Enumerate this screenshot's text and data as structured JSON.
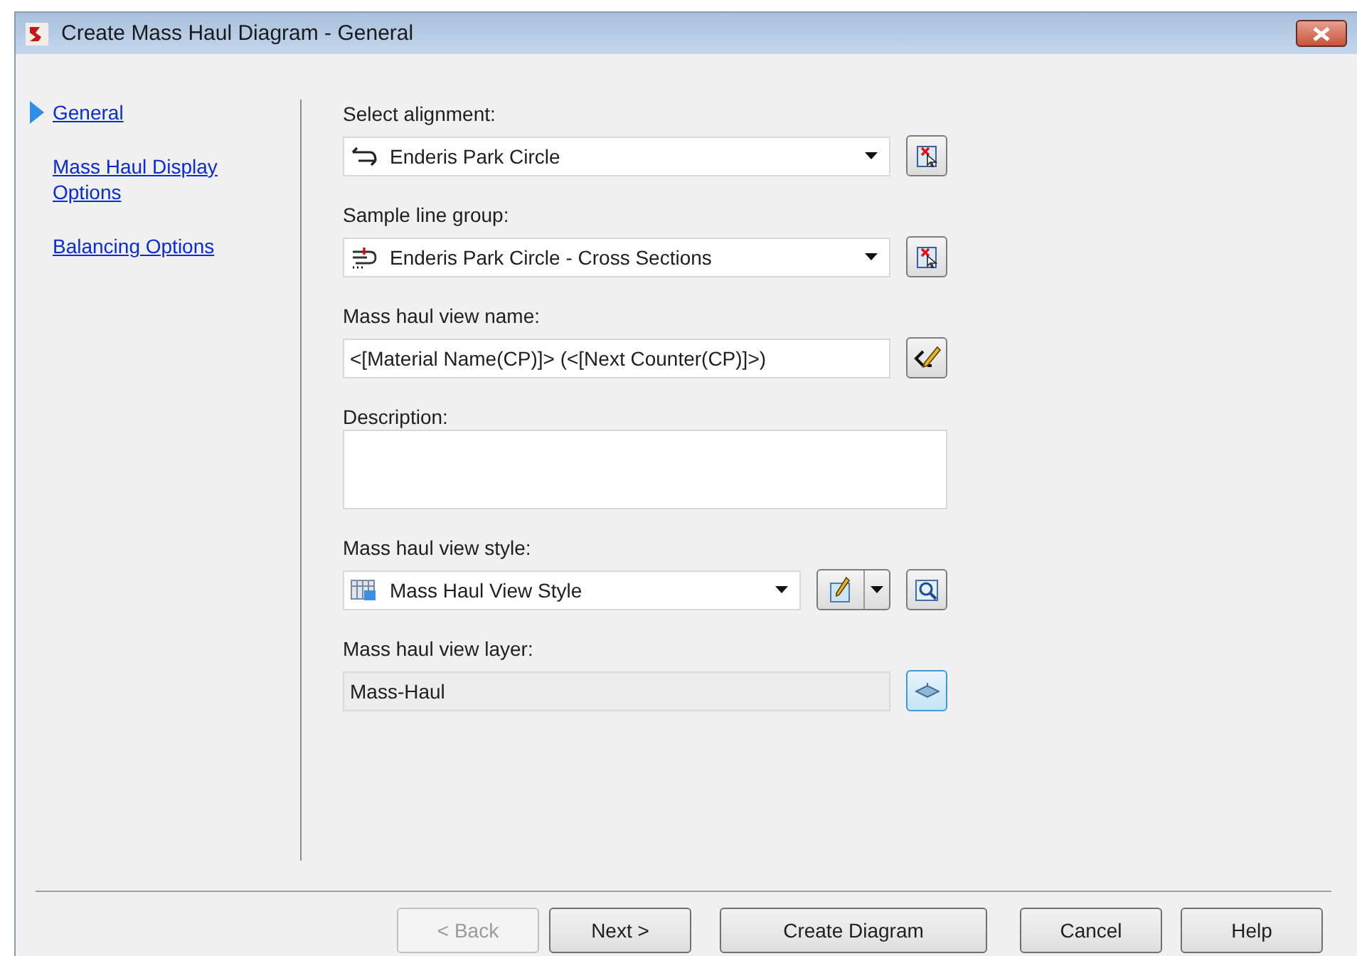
{
  "window": {
    "title": "Create Mass Haul Diagram - General"
  },
  "nav": [
    {
      "label": "General",
      "selected": true
    },
    {
      "label": "Mass Haul Display Options",
      "selected": false
    },
    {
      "label": "Balancing Options",
      "selected": false
    }
  ],
  "fields": [
    {
      "label": "Select alignment:",
      "kind": "dropdown",
      "value": "Enderis Park Circle",
      "disabled": false,
      "tools": [
        {
          "kind": "pick",
          "focused": false
        }
      ]
    },
    {
      "label": "Sample line group:",
      "kind": "dropdown",
      "value": "Enderis Park Circle - Cross Sections",
      "disabled": false,
      "tools": [
        {
          "kind": "pick",
          "focused": false
        }
      ]
    },
    {
      "label": "Mass haul view name:",
      "kind": "text",
      "value": "<[Material Name(CP)]> (<[Next Counter(CP)]>)",
      "disabled": false,
      "tools": [
        {
          "kind": "edit-name",
          "focused": false
        }
      ]
    },
    {
      "label": "Description:",
      "kind": "textarea"
    },
    {
      "label": "Mass haul view style:",
      "kind": "dropdown",
      "value": "Mass Haul View Style",
      "disabled": false,
      "tools": [
        {
          "kind": "edit-split",
          "focused": false
        },
        {
          "kind": "preview",
          "focused": false
        }
      ]
    },
    {
      "label": "Mass haul view layer:",
      "kind": "text",
      "value": "Mass-Haul",
      "disabled": true,
      "tools": [
        {
          "kind": "layer",
          "focused": true
        }
      ]
    }
  ],
  "buttons": [
    {
      "label": "< Back",
      "disabled": true
    },
    {
      "label": "Next >",
      "disabled": false
    },
    {
      "label": "Create Diagram",
      "disabled": false
    },
    {
      "label": "Cancel",
      "disabled": false
    },
    {
      "label": "Help",
      "disabled": false
    }
  ]
}
